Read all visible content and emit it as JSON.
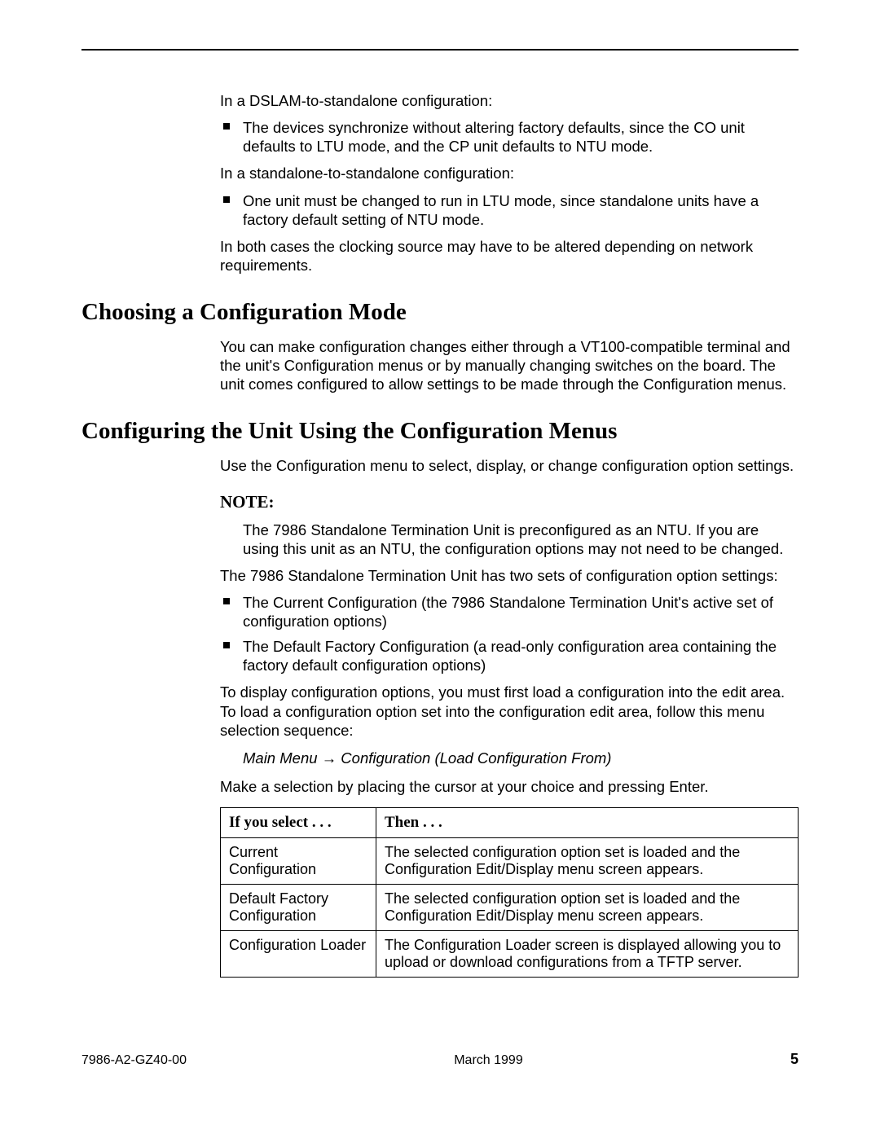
{
  "intro": {
    "p1": "In a DSLAM-to-standalone configuration:",
    "b1": "The devices synchronize without altering factory defaults, since the CO unit defaults to LTU mode, and the CP unit defaults to NTU mode.",
    "p2": "In a standalone-to-standalone configuration:",
    "b2": "One unit must be changed to run in LTU mode, since standalone units have a factory default setting of NTU mode.",
    "p3": "In both cases the clocking source may have to be altered depending on network requirements."
  },
  "sec1": {
    "title": "Choosing a Configuration Mode",
    "p1": "You can make configuration changes either through a VT100-compatible terminal and the unit's Configuration menus or by manually changing switches on the board. The unit comes configured to allow settings to be made through the Configuration menus."
  },
  "sec2": {
    "title": "Configuring the Unit Using the Configuration Menus",
    "p1": "Use the Configuration menu to select, display, or change configuration option settings.",
    "note_head": "NOTE:",
    "note_body": "The 7986 Standalone Termination Unit is preconfigured as an NTU. If you are using this unit as an NTU, the configuration options may not need to be changed.",
    "p2": "The 7986 Standalone Termination Unit has two sets of configuration option settings:",
    "b1": "The Current Configuration (the 7986 Standalone Termination Unit's active set of configuration options)",
    "b2": "The Default Factory Configuration (a read-only configuration area containing the factory default configuration options)",
    "p3": "To display configuration options, you must first load a configuration into the edit area. To load a configuration option set into the configuration edit area, follow this menu selection sequence:",
    "menuseq_a": "Main Menu ",
    "menuseq_b": " Configuration (Load Configuration From)",
    "p4": "Make a selection by placing the cursor at your choice and pressing Enter."
  },
  "table": {
    "h1": "If you select . . .",
    "h2": "Then . . .",
    "rows": [
      {
        "if": "Current Configuration",
        "then": "The selected configuration option set is loaded and the Configuration Edit/Display menu screen appears."
      },
      {
        "if": "Default Factory Configuration",
        "then": "The selected configuration option set is loaded and the Configuration Edit/Display menu screen appears."
      },
      {
        "if": "Configuration Loader",
        "then": "The Configuration Loader screen is displayed allowing you to upload or download configurations from a TFTP server."
      }
    ]
  },
  "footer": {
    "docid": "7986-A2-GZ40-00",
    "date": "March 1999",
    "page": "5"
  }
}
